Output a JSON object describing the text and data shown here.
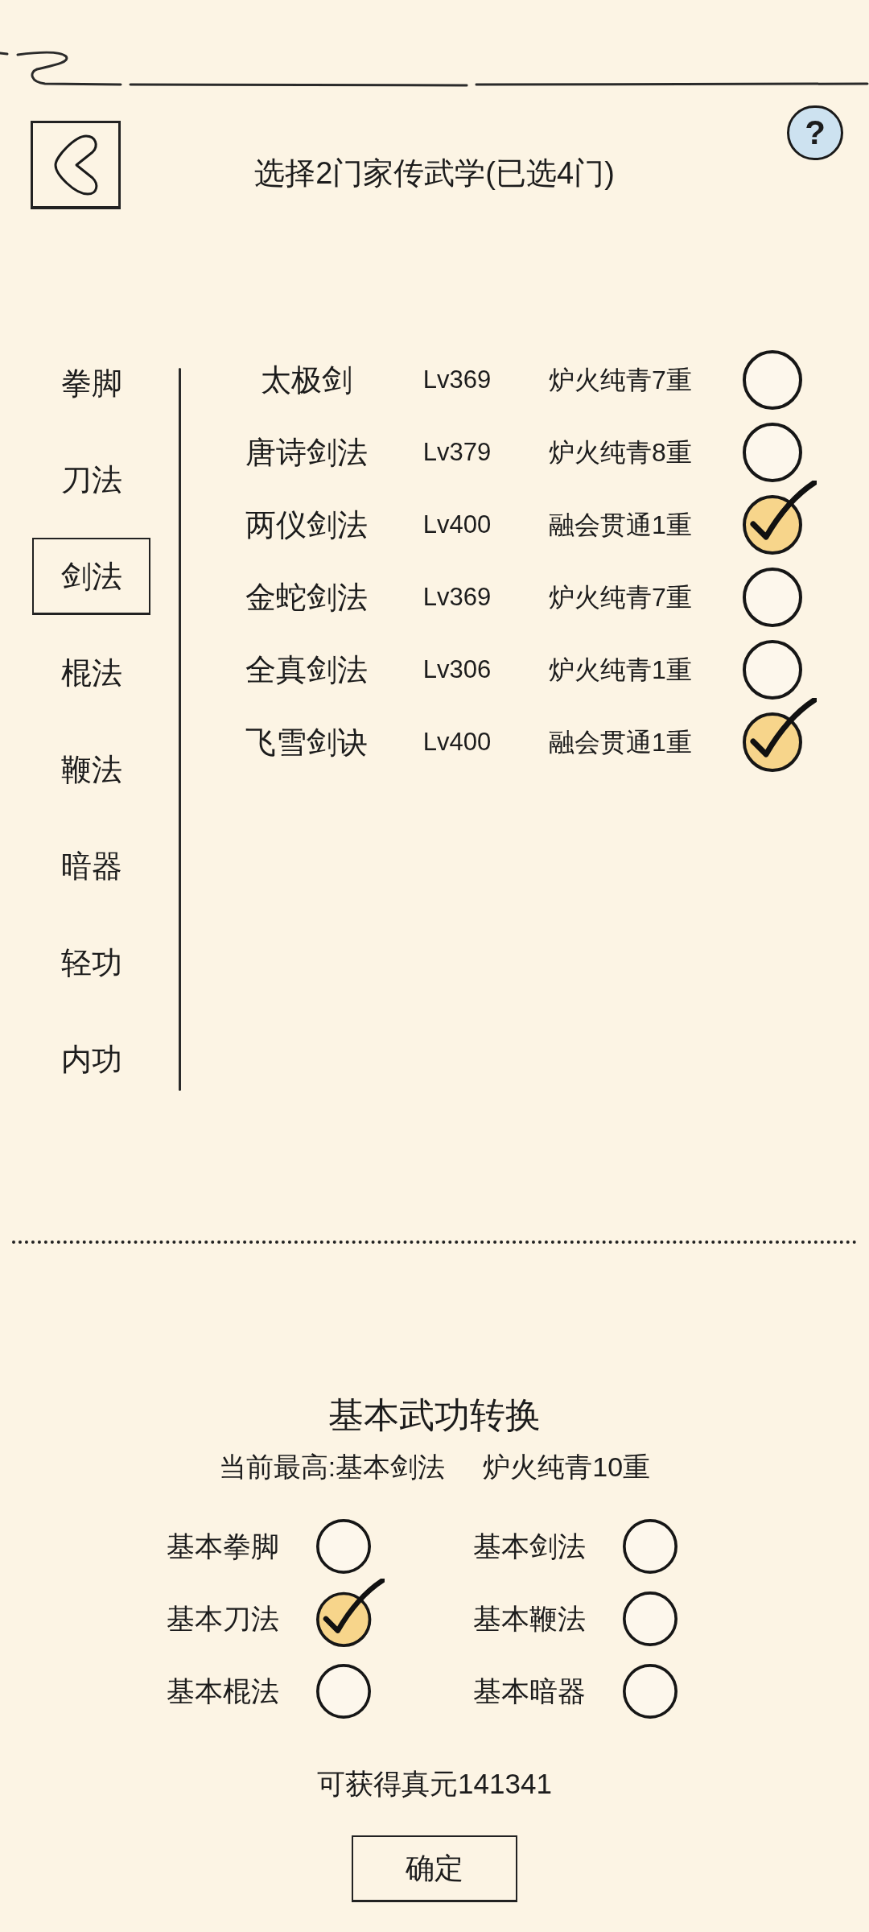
{
  "header": {
    "title": "选择2门家传武学(已选4门)",
    "help": "?"
  },
  "categories": [
    {
      "label": "拳脚",
      "selected": false
    },
    {
      "label": "刀法",
      "selected": false
    },
    {
      "label": "剑法",
      "selected": true
    },
    {
      "label": "棍法",
      "selected": false
    },
    {
      "label": "鞭法",
      "selected": false
    },
    {
      "label": "暗器",
      "selected": false
    },
    {
      "label": "轻功",
      "selected": false
    },
    {
      "label": "内功",
      "selected": false
    }
  ],
  "skills": [
    {
      "name": "太极剑",
      "lv": "Lv369",
      "realm": "炉火纯青7重",
      "checked": false
    },
    {
      "name": "唐诗剑法",
      "lv": "Lv379",
      "realm": "炉火纯青8重",
      "checked": false
    },
    {
      "name": "两仪剑法",
      "lv": "Lv400",
      "realm": "融会贯通1重",
      "checked": true
    },
    {
      "name": "金蛇剑法",
      "lv": "Lv369",
      "realm": "炉火纯青7重",
      "checked": false
    },
    {
      "name": "全真剑法",
      "lv": "Lv306",
      "realm": "炉火纯青1重",
      "checked": false
    },
    {
      "name": "飞雪剑诀",
      "lv": "Lv400",
      "realm": "融会贯通1重",
      "checked": true
    }
  ],
  "conversion": {
    "title": "基本武功转换",
    "current_best": "当前最高:基本剑法",
    "current_realm": "炉火纯青10重",
    "options": [
      {
        "label": "基本拳脚",
        "checked": false
      },
      {
        "label": "基本剑法",
        "checked": false
      },
      {
        "label": "基本刀法",
        "checked": true
      },
      {
        "label": "基本鞭法",
        "checked": false
      },
      {
        "label": "基本棍法",
        "checked": false
      },
      {
        "label": "基本暗器",
        "checked": false
      }
    ],
    "reward": "可获得真元141341",
    "confirm": "确定"
  }
}
